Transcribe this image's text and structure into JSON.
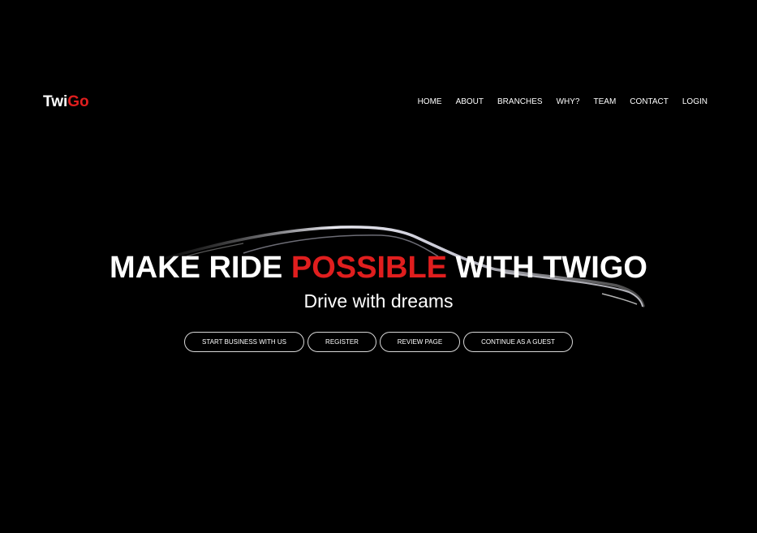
{
  "brand": {
    "logo_part1": "Twi",
    "logo_part2": "Go",
    "accent_color": "#e01e1e",
    "background_color": "#000000"
  },
  "nav": {
    "items": [
      {
        "label": "HOME"
      },
      {
        "label": "ABOUT"
      },
      {
        "label": "BRANCHES"
      },
      {
        "label": "WHY?"
      },
      {
        "label": "TEAM"
      },
      {
        "label": "CONTACT"
      },
      {
        "label": "LOGIN"
      }
    ]
  },
  "hero": {
    "title_part1": "MAKE RIDE ",
    "title_accent": "POSSIBLE",
    "title_part2": " WITH TWIGO",
    "subtitle": "Drive with dreams",
    "background_image": "car-silhouette"
  },
  "actions": {
    "start_business": "START BUSINESS WITH US",
    "register": "REGISTER",
    "review_page": "REVIEW PAGE",
    "continue_guest": "CONTINUE AS A GUEST"
  }
}
